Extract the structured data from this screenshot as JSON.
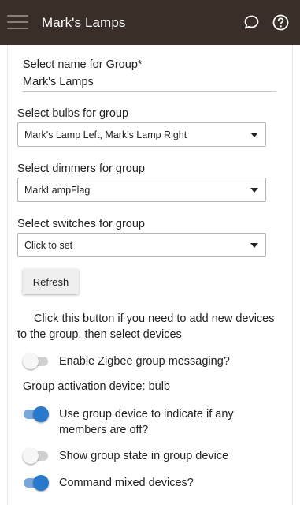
{
  "app": {
    "title": "Mark's Lamps"
  },
  "name_field": {
    "label": "Select name for Group*",
    "value": "Mark's Lamps"
  },
  "selects": [
    {
      "label": "Select bulbs for group",
      "value": "Mark's Lamp Left, Mark's Lamp Right"
    },
    {
      "label": "Select dimmers for group",
      "value": "MarkLampFlag"
    },
    {
      "label": "Select switches for group",
      "value": "Click to set"
    }
  ],
  "refresh": {
    "label": "Refresh"
  },
  "hint": {
    "line1": "Click this button if you need to add new devices",
    "line2": "to the group, then select devices"
  },
  "toggles": [
    {
      "label": "Enable Zigbee group messaging?",
      "on": false
    },
    {
      "label_line1": "Use group device to indicate if any",
      "label_line2": "members are off?",
      "on": true
    },
    {
      "label": "Show group state in group device",
      "on": false
    },
    {
      "label": "Command mixed devices?",
      "on": true
    }
  ],
  "activation": {
    "label": "Group activation device:",
    "value": "bulb"
  },
  "icons": {
    "menu": "hamburger-menu-icon",
    "chat": "chat-bubble-icon",
    "help": "help-circle-icon"
  },
  "colors": {
    "appbar": "#3a2e28",
    "toggle_on": "#2a78cc"
  }
}
